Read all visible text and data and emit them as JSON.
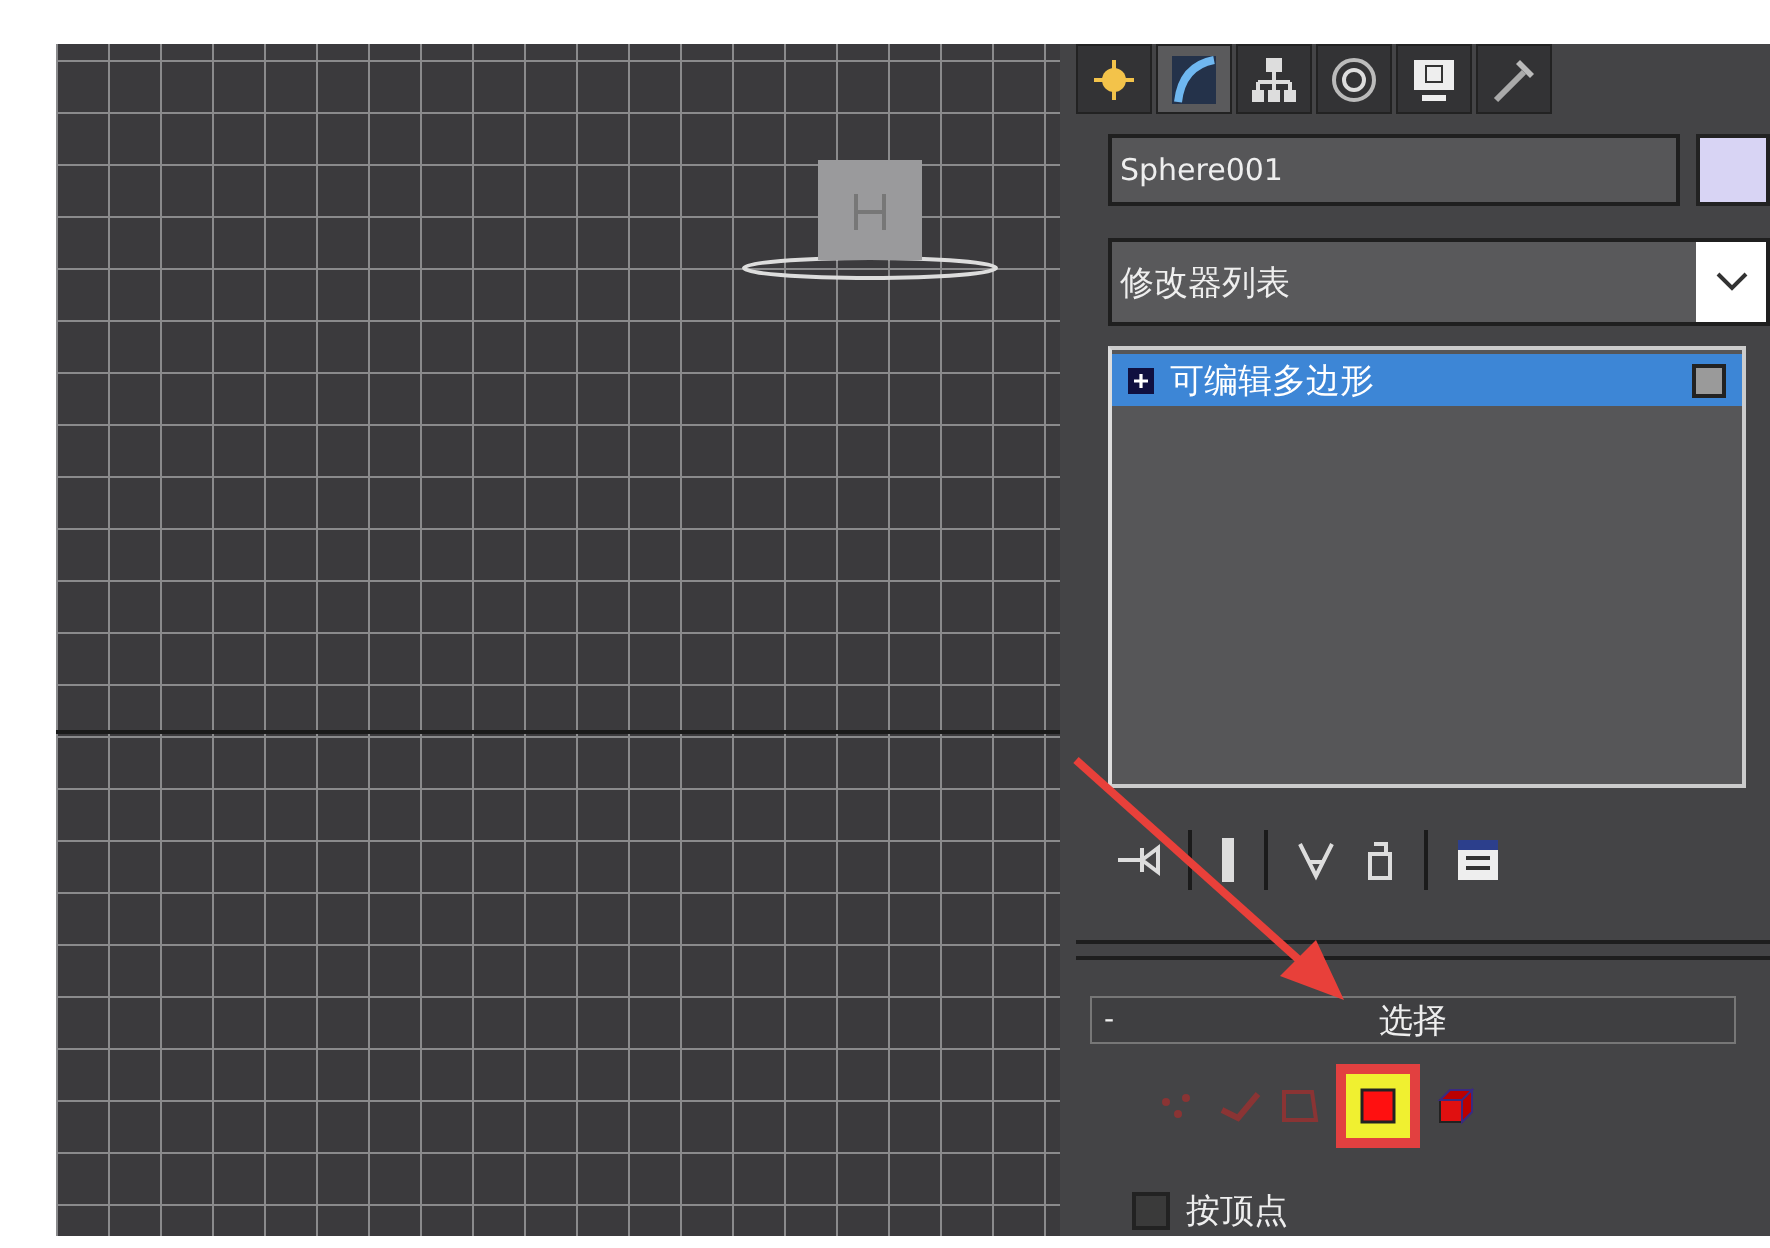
{
  "command_tabs": [
    {
      "kind": "create",
      "selected": false
    },
    {
      "kind": "modify",
      "selected": true
    },
    {
      "kind": "hierarchy",
      "selected": false
    },
    {
      "kind": "motion",
      "selected": false
    },
    {
      "kind": "display",
      "selected": false
    },
    {
      "kind": "utilities",
      "selected": false
    }
  ],
  "object_name": {
    "value": "Sphere001",
    "color": "#d8d4f4"
  },
  "modifier_list": {
    "label": "修改器列表"
  },
  "modifier_stack": [
    {
      "label": "可编辑多边形",
      "selected": true
    }
  ],
  "stack_tools": [
    {
      "kind": "pin"
    },
    {
      "kind": "end-result"
    },
    {
      "kind": "make-unique"
    },
    {
      "kind": "remove"
    },
    {
      "kind": "configure"
    }
  ],
  "selection_rollout": {
    "collapse": "-",
    "title": "选择",
    "levels": [
      {
        "kind": "vertex",
        "selected": false
      },
      {
        "kind": "edge",
        "selected": false
      },
      {
        "kind": "border",
        "selected": false
      },
      {
        "kind": "polygon",
        "selected": true
      },
      {
        "kind": "element",
        "selected": false
      }
    ],
    "by_vertex": {
      "label": "按顶点",
      "checked": false
    }
  }
}
